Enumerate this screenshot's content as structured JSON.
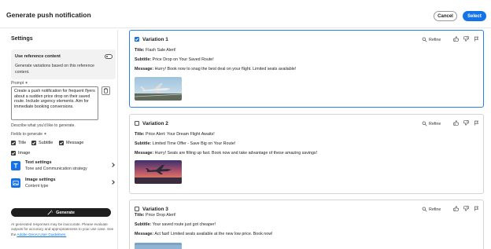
{
  "header": {
    "title": "Generate push notification",
    "cancel_label": "Cancel",
    "select_label": "Select"
  },
  "settings": {
    "title": "Settings",
    "reference": {
      "title": "Use reference content",
      "description": "Generate variations based on this reference content."
    },
    "prompt_label": "Prompt ✶",
    "prompt_text": "Create a push notification for frequent flyers about a sudden price drop on their saved route. Include urgency elements. Aim for immediate booking conversions.",
    "prompt_help": "Describe what you'd like to generate.",
    "fields_label": "Fields to generate ✶",
    "fields": [
      "Title",
      "Subtitle",
      "Message",
      "Image"
    ],
    "text_settings": {
      "title": "Text settings",
      "description": "Tone and Communication strategy"
    },
    "image_settings": {
      "title": "Image settings",
      "description": "Content type"
    },
    "generate_label": "Generate",
    "disclaimer": "AI generated responses may be inaccurate. Please evaluate outputs for accuracy and appropriateness to your use case. See the",
    "disclaimer_link": "Adobe GenAI User Guidelines."
  },
  "labels": {
    "title": "Title:",
    "subtitle": "Subtitle:",
    "message": "Message:",
    "refine": "Refine"
  },
  "variations": [
    {
      "name": "Variation 1",
      "title": "Flash Sale Alert!",
      "subtitle": "Price Drop on Your Saved Route!",
      "message": "Hurry! Book now to snag the best deal on your flight. Limited seats available!",
      "selected": true
    },
    {
      "name": "Variation 2",
      "title": "Price Alert: Your Dream Flight Awaits!",
      "subtitle": "Limited Time Offer - Save Big on Your Route!",
      "message": "Hurry! Seats are filling up fast. Book now and take advantage of these amazing savings!",
      "selected": false
    },
    {
      "name": "Variation 3",
      "title": "Price Drop Alert!",
      "subtitle": "Your saved route just got cheaper!",
      "message": "Act fast! Limited seats available at the new low price. Book now!",
      "selected": false
    }
  ],
  "colors": {
    "accent": "#1473e6",
    "selected_border": "#2680eb",
    "generate_button": "#1f1f1f"
  }
}
